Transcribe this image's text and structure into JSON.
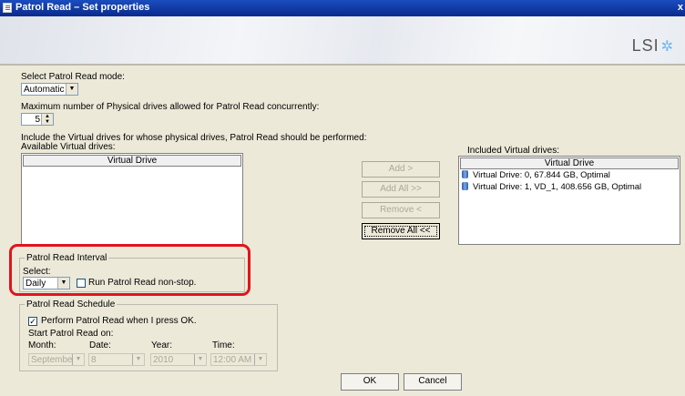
{
  "window": {
    "title": "Patrol Read – Set properties",
    "close_glyph": "x"
  },
  "brand": {
    "logo_text": "LSI"
  },
  "mode": {
    "label": "Select Patrol Read mode:",
    "value": "Automatic"
  },
  "max_drives": {
    "label": "Maximum number of Physical drives allowed for Patrol Read concurrently:",
    "value": "5"
  },
  "include_text": "Include the Virtual drives for whose physical drives, Patrol Read should be performed:",
  "available": {
    "label": "Available Virtual drives:",
    "column": "Virtual Drive",
    "items": []
  },
  "included": {
    "label": "Included Virtual drives:",
    "column": "Virtual Drive",
    "items": [
      "Virtual Drive: 0, 67.844 GB, Optimal",
      "Virtual Drive: 1, VD_1, 408.656 GB, Optimal"
    ]
  },
  "transfer_buttons": {
    "add": "Add >",
    "add_all": "Add All >>",
    "remove": "Remove <",
    "remove_all": "Remove All <<"
  },
  "interval": {
    "group_label": "Patrol Read Interval",
    "select_label": "Select:",
    "select_value": "Daily",
    "nonstop_label": "Run Patrol Read non-stop.",
    "nonstop_checked": false
  },
  "schedule": {
    "group_label": "Patrol Read Schedule",
    "perform_label": "Perform Patrol Read when I press OK.",
    "perform_checked": true,
    "start_label": "Start Patrol Read on:",
    "month_label": "Month:",
    "month_value": "September",
    "date_label": "Date:",
    "date_value": "8",
    "year_label": "Year:",
    "year_value": "2010",
    "time_label": "Time:",
    "time_value": "12:00 AM"
  },
  "footer": {
    "ok": "OK",
    "cancel": "Cancel"
  },
  "colors": {
    "titlebar": "#0a2a8c",
    "highlight": "#e0141e",
    "dialog_bg": "#ece9d8"
  }
}
